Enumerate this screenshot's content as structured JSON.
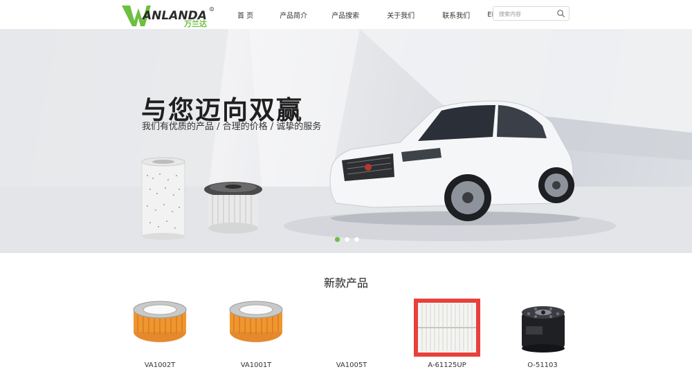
{
  "header": {
    "logo_text": "WANLANDA",
    "logo_sub": "万兰达",
    "nav": [
      {
        "label": "首 页"
      },
      {
        "label": "产品简介"
      },
      {
        "label": "产品搜索"
      },
      {
        "label": "关于我们"
      },
      {
        "label": "联系我们"
      },
      {
        "label": "EN"
      }
    ],
    "search": {
      "placeholder": "搜索内容"
    }
  },
  "banner": {
    "headline": "与您迈向双赢",
    "subline": "我们有优质的产品 / 合理的价格 / 诚挚的服务",
    "slide_count": 3,
    "active_slide": 1
  },
  "products": {
    "title": "新款产品",
    "items": [
      {
        "name": "VA1002T",
        "icon": "air-filter-round-icon"
      },
      {
        "name": "VA1001T",
        "icon": "air-filter-round-icon"
      },
      {
        "name": "VA1005T",
        "icon": "blank-image"
      },
      {
        "name": "A-61125UP",
        "icon": "panel-air-filter-icon"
      },
      {
        "name": "O-51103",
        "icon": "oil-filter-icon"
      }
    ]
  },
  "colors": {
    "brand_green": "#6cbf3f",
    "dark_text": "#1f1f1f"
  }
}
